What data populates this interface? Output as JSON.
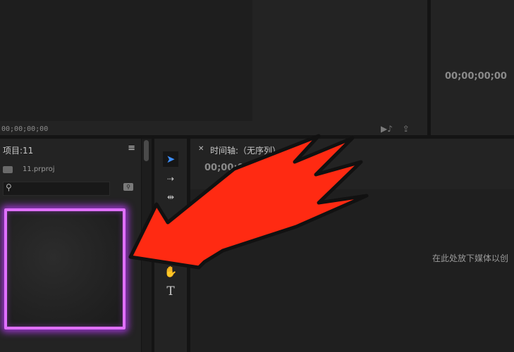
{
  "source_monitor": {
    "timecode": "00;00;00;00"
  },
  "program_monitor": {
    "timecode": "00;00;00;00"
  },
  "project": {
    "title": "项目:11",
    "file_name": "11.prproj",
    "search": {
      "value": "",
      "placeholder": ""
    }
  },
  "tools": {
    "items": [
      "selection-tool",
      "track-select-tool",
      "ripple-edit-tool",
      "hand-tool",
      "type-tool"
    ]
  },
  "timeline": {
    "title": "时间轴:（无序列）",
    "timecode": "00;00;00;0",
    "drop_hint": "在此处放下媒体以创"
  },
  "annotation": {
    "arrow_color": "#ff2a12",
    "highlight_color": "#e070ff"
  },
  "colors": {
    "accent": "#3d8fff",
    "panel": "#232323",
    "background": "#141414"
  }
}
